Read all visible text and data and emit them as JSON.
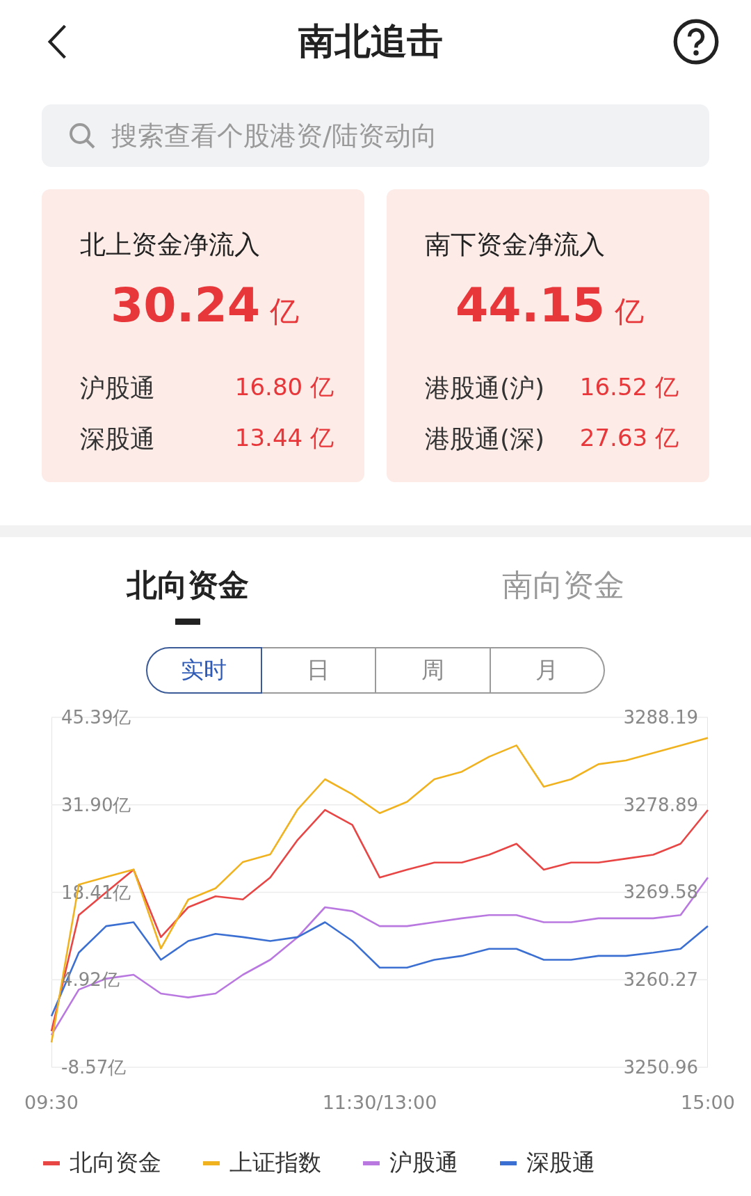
{
  "header": {
    "title": "南北追击"
  },
  "search": {
    "placeholder": "搜索查看个股港资/陆资动向"
  },
  "cards": [
    {
      "title": "北上资金净流入",
      "amount": "30.24",
      "unit": "亿",
      "rows": [
        {
          "label": "沪股通",
          "value": "16.80 亿"
        },
        {
          "label": "深股通",
          "value": "13.44 亿"
        }
      ]
    },
    {
      "title": "南下资金净流入",
      "amount": "44.15",
      "unit": "亿",
      "rows": [
        {
          "label": "港股通(沪)",
          "value": "16.52 亿"
        },
        {
          "label": "港股通(深)",
          "value": "27.63 亿"
        }
      ]
    }
  ],
  "tabs": [
    {
      "label": "北向资金",
      "selected": true
    },
    {
      "label": "南向资金",
      "selected": false
    }
  ],
  "periods": [
    {
      "label": "实时",
      "selected": true
    },
    {
      "label": "日",
      "selected": false
    },
    {
      "label": "周",
      "selected": false
    },
    {
      "label": "月",
      "selected": false
    }
  ],
  "chart_data": {
    "type": "line",
    "grid": true,
    "x": [
      9.5,
      9.729,
      9.958,
      10.188,
      10.417,
      10.646,
      10.875,
      11.104,
      11.333,
      11.563,
      11.792,
      12.021,
      12.25,
      12.479,
      12.708,
      12.938,
      13.167,
      13.396,
      13.625,
      13.854,
      14.083,
      14.313,
      14.542,
      14.771,
      15
    ],
    "xlim": [
      9.5,
      15
    ],
    "xticks": [
      {
        "value": 9.5,
        "label": "09:30"
      },
      {
        "value": 12.25,
        "label": "11:30/13:00"
      },
      {
        "value": 15,
        "label": "15:00"
      }
    ],
    "ylim": [
      -8.57,
      45.39
    ],
    "yticks": [
      {
        "value": 45.39,
        "label": "45.39亿"
      },
      {
        "value": 31.9,
        "label": "31.90亿"
      },
      {
        "value": 18.41,
        "label": "18.41亿"
      },
      {
        "value": 4.92,
        "label": "4.92亿"
      },
      {
        "value": -8.57,
        "label": "-8.57亿"
      }
    ],
    "series": [
      {
        "name": "北向资金",
        "color": "#e84545",
        "values": [
          -3.0,
          14.9,
          18.4,
          21.9,
          11.5,
          16.1,
          17.8,
          17.3,
          20.7,
          26.5,
          31.1,
          28.8,
          20.7,
          21.9,
          23.0,
          23.0,
          24.2,
          25.9,
          21.9,
          23.0,
          23.0,
          23.6,
          24.2,
          25.9,
          31.1
        ]
      },
      {
        "name": "沪股通",
        "color": "#b978e0",
        "values": [
          -3.6,
          3.4,
          5.1,
          5.7,
          2.8,
          2.2,
          2.8,
          5.7,
          8.0,
          11.5,
          16.1,
          15.5,
          13.2,
          13.2,
          13.8,
          14.4,
          14.9,
          14.9,
          13.8,
          13.8,
          14.4,
          14.4,
          14.4,
          14.9,
          20.7
        ]
      },
      {
        "name": "深股通",
        "color": "#3b6fd1",
        "values": [
          -0.7,
          9.1,
          13.2,
          13.8,
          8.0,
          10.9,
          12.0,
          11.5,
          10.9,
          11.5,
          13.8,
          10.9,
          6.8,
          6.8,
          8.0,
          8.6,
          9.7,
          9.7,
          8.0,
          8.0,
          8.6,
          8.6,
          9.1,
          9.7,
          13.2
        ]
      }
    ]
  },
  "index_overlay": {
    "chart_data": {
      "type": "line",
      "x": [
        9.5,
        9.729,
        9.958,
        10.188,
        10.417,
        10.646,
        10.875,
        11.104,
        11.333,
        11.563,
        11.792,
        12.021,
        12.25,
        12.479,
        12.708,
        12.938,
        13.167,
        13.396,
        13.625,
        13.854,
        14.083,
        14.313,
        14.542,
        14.771,
        15
      ],
      "xlim": [
        9.5,
        15
      ],
      "ylim": [
        3250.96,
        3288.19
      ],
      "yticks": [
        {
          "value": 3288.19,
          "label": "3288.19"
        },
        {
          "value": 3278.89,
          "label": "3278.89"
        },
        {
          "value": 3269.58,
          "label": "3269.58"
        },
        {
          "value": 3260.27,
          "label": "3260.27"
        },
        {
          "value": 3250.96,
          "label": "3250.96"
        }
      ],
      "series": [
        {
          "name": "上证指数",
          "color": "#f0b21f",
          "values": [
            3253.6,
            3270.4,
            3271.2,
            3272.0,
            3263.6,
            3268.8,
            3270.0,
            3272.8,
            3273.6,
            3278.4,
            3281.6,
            3280.0,
            3278.0,
            3279.2,
            3281.6,
            3282.4,
            3284.0,
            3285.2,
            3280.8,
            3281.6,
            3283.2,
            3283.6,
            3284.4,
            3285.2,
            3286.0
          ]
        }
      ]
    }
  }
}
